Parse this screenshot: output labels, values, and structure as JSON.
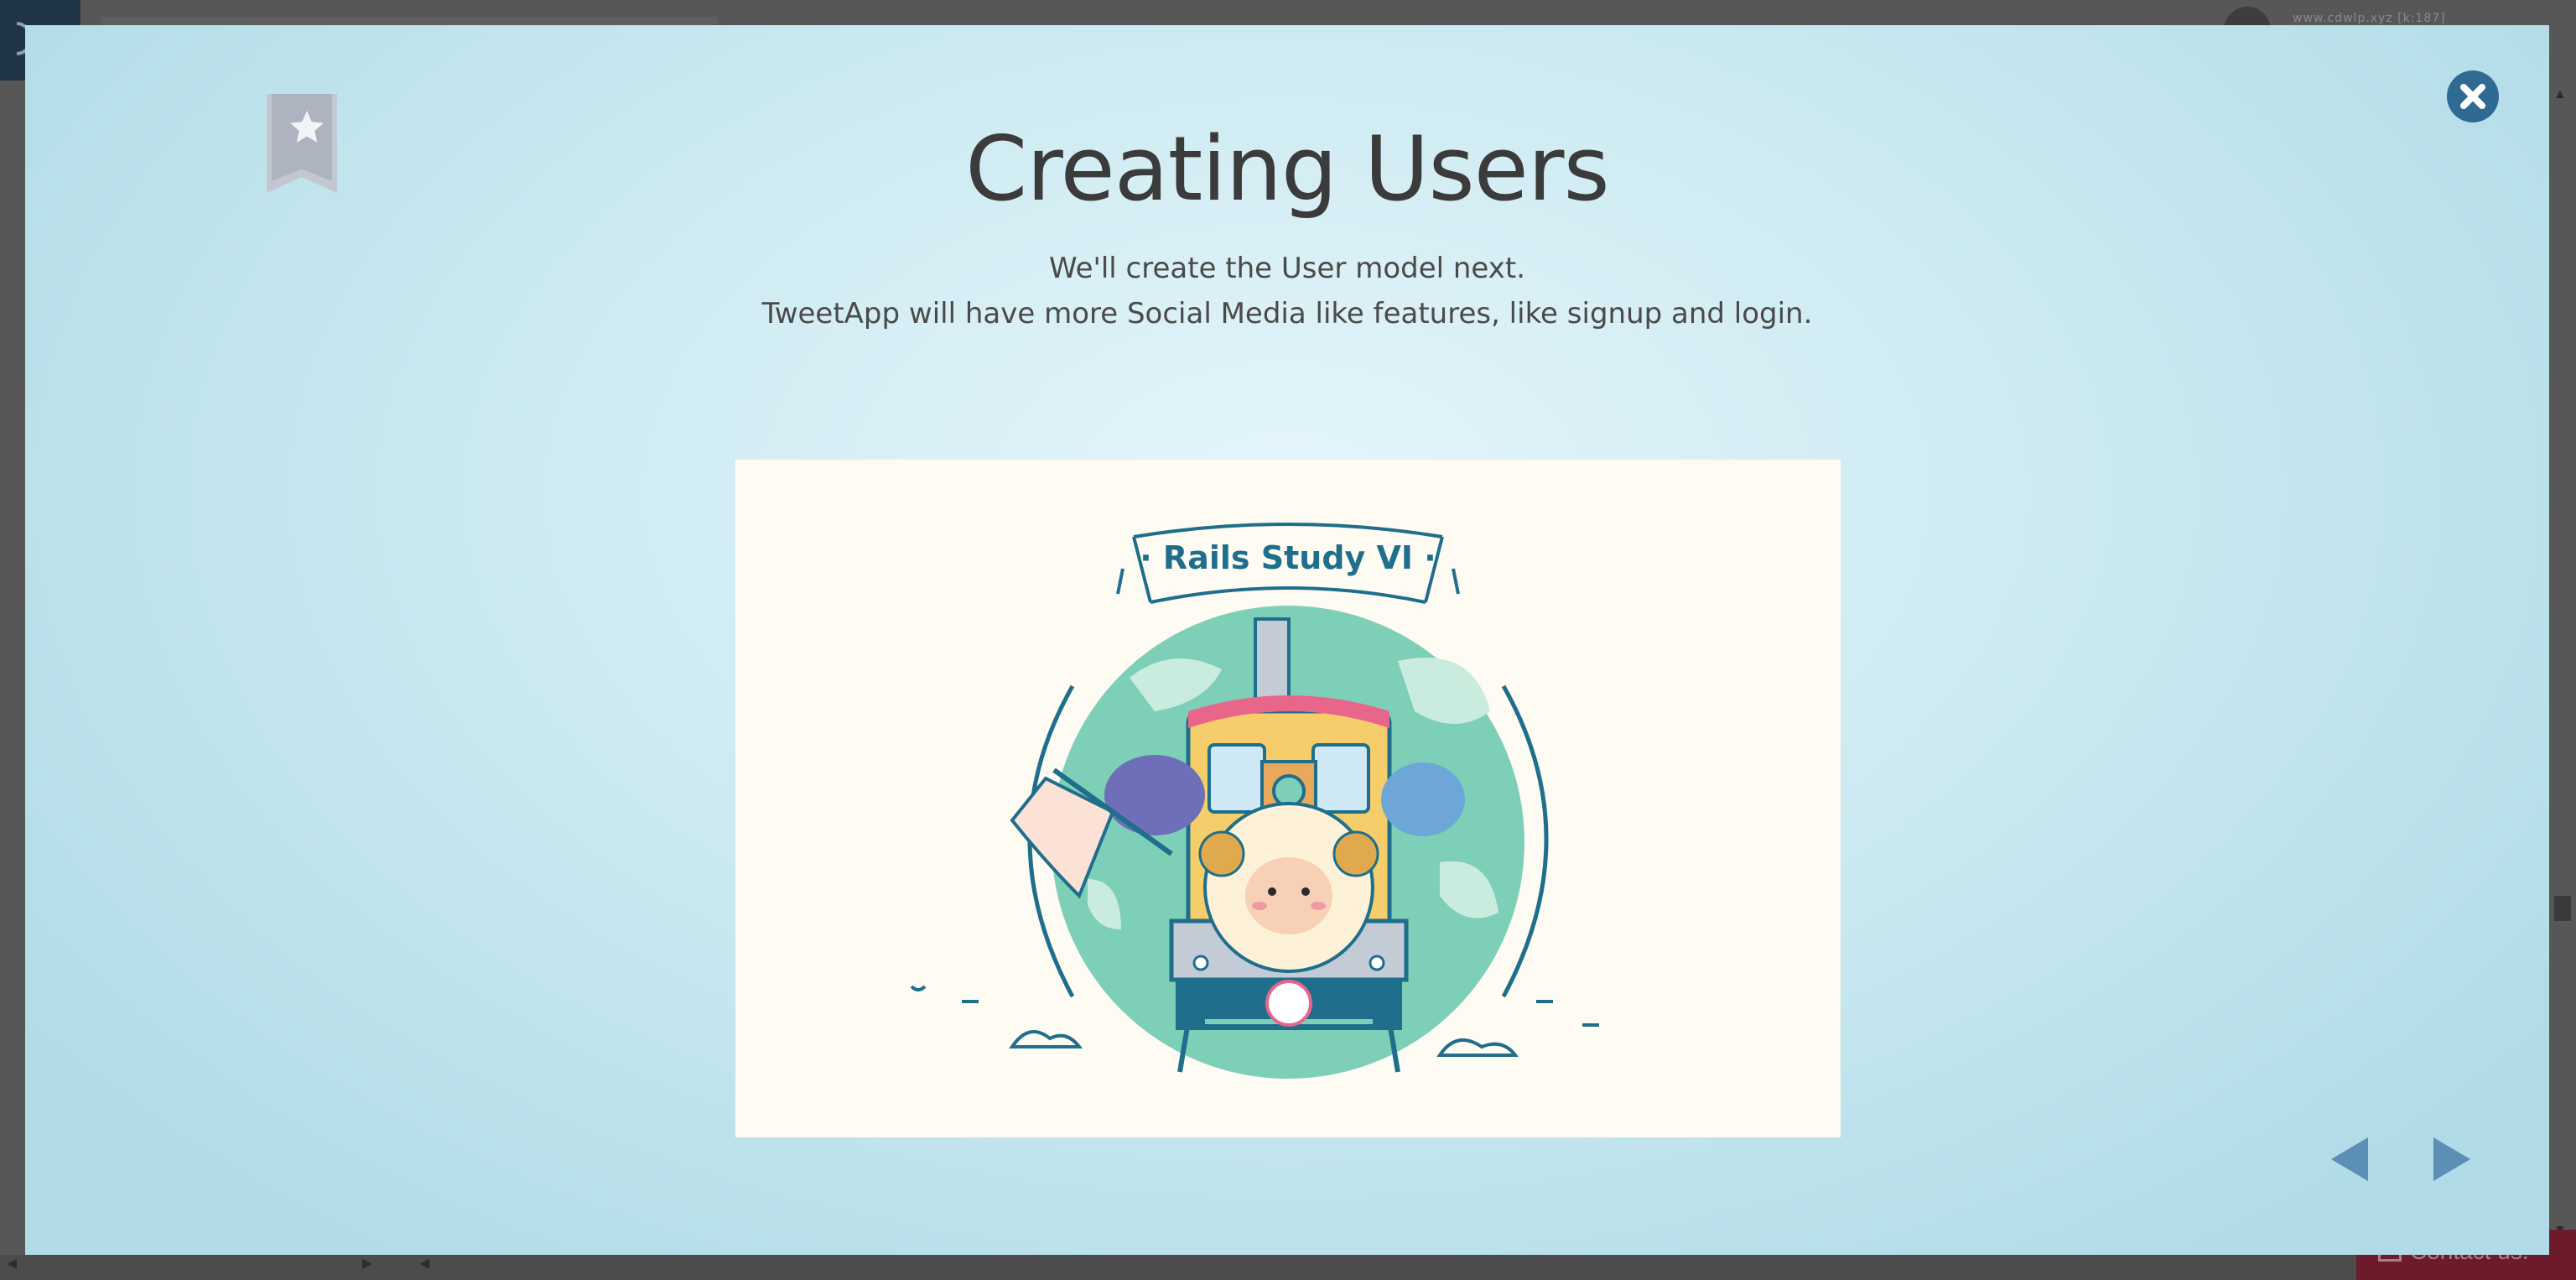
{
  "background_page": {
    "url_text": "www.cdwlp.xyz [k:187]",
    "contact_label": "Contact us."
  },
  "modal": {
    "title": "Creating Users",
    "subtitle_line1": "We'll create the User model next.",
    "subtitle_line2": "TweetApp will have more Social Media like features, like signup and login.",
    "image": {
      "banner_text": "· Rails Study VI ·"
    }
  },
  "colors": {
    "modal_center": "#e4f5fa",
    "modal_edge": "#b0dbe7",
    "close_button": "#2e6a92",
    "nav_arrows": "#5b8fb5",
    "bookmark": "#c3c7d1"
  },
  "icons": {
    "bookmark": "star-bookmark-icon",
    "close": "close-circle-icon",
    "prev": "triangle-left-icon",
    "next": "triangle-right-icon"
  }
}
